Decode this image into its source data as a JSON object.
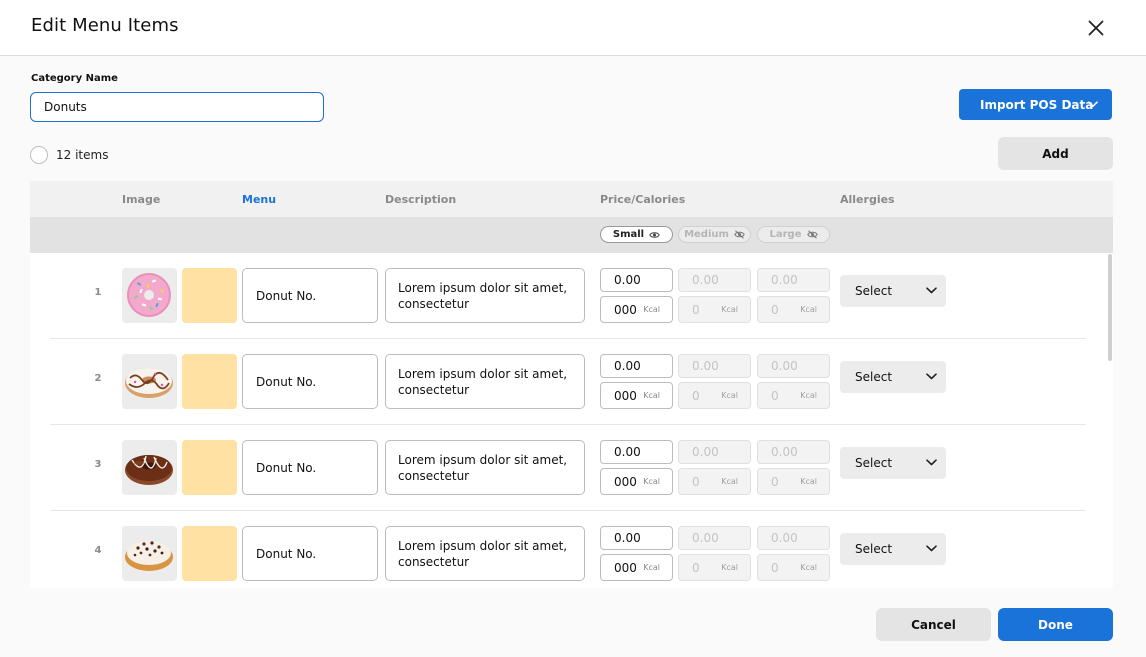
{
  "dialog": {
    "title": "Edit Menu Items"
  },
  "category": {
    "label": "Category Name",
    "value": "Donuts"
  },
  "import_button": {
    "label": "Import POS Data"
  },
  "item_count": "12 items",
  "add_button": {
    "label": "Add"
  },
  "table": {
    "headers": {
      "image": "Image",
      "menu": "Menu",
      "description": "Description",
      "price_calories": "Price/Calories",
      "allergies": "Allergies"
    },
    "sizes": [
      {
        "label": "Small",
        "enabled": true
      },
      {
        "label": "Medium",
        "enabled": false
      },
      {
        "label": "Large",
        "enabled": false
      }
    ],
    "rows": [
      {
        "number": "1",
        "image": "sprinkle-donut-image",
        "name": "Donut No.",
        "description": "Lorem ipsum dolor sit amet, consectetur",
        "prices": [
          "0.00",
          "0.00",
          "0.00"
        ],
        "calories": [
          "000",
          "0",
          "0"
        ],
        "kcal_unit": "Kcal",
        "allergies": "Select"
      },
      {
        "number": "2",
        "image": "drizzle-donut-image",
        "name": "Donut No.",
        "description": "Lorem ipsum dolor sit amet, consectetur",
        "prices": [
          "0.00",
          "0.00",
          "0.00"
        ],
        "calories": [
          "000",
          "0",
          "0"
        ],
        "kcal_unit": "Kcal",
        "allergies": "Select"
      },
      {
        "number": "3",
        "image": "chocolate-donut-image",
        "name": "Donut No.",
        "description": "Lorem ipsum dolor sit amet, consectetur",
        "prices": [
          "0.00",
          "0.00",
          "0.00"
        ],
        "calories": [
          "000",
          "0",
          "0"
        ],
        "kcal_unit": "Kcal",
        "allergies": "Select"
      },
      {
        "number": "4",
        "image": "crumb-donut-image",
        "name": "Donut No.",
        "description": "Lorem ipsum dolor sit amet, consectetur",
        "prices": [
          "0.00",
          "0.00",
          "0.00"
        ],
        "calories": [
          "000",
          "0",
          "0"
        ],
        "kcal_unit": "Kcal",
        "allergies": "Select"
      }
    ]
  },
  "footer": {
    "cancel_label": "Cancel",
    "done_label": "Done"
  },
  "colors": {
    "primary": "#1a73d9",
    "swatch": "#ffe2a3",
    "secondary_button": "#e4e4e4"
  }
}
